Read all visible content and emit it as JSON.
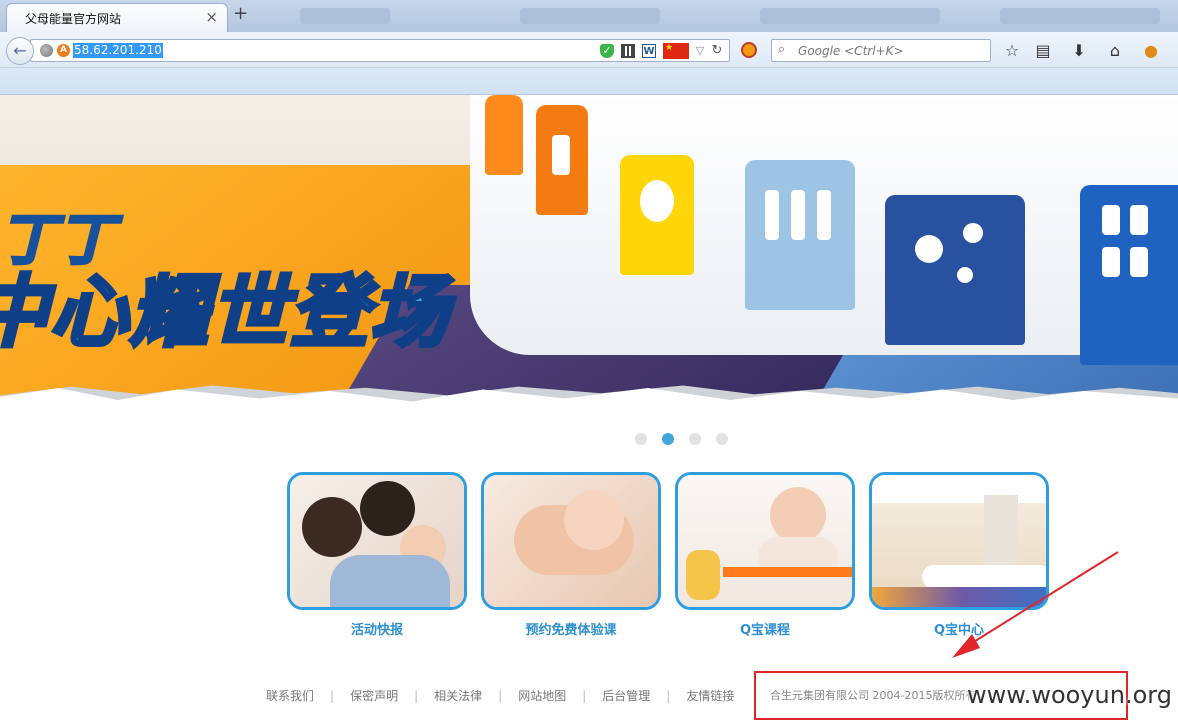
{
  "browser": {
    "tab_title": "父母能量官方网站",
    "tab_close": "×",
    "new_tab": "+",
    "url": "58.62.201.210",
    "search_placeholder": "Google <Ctrl+K>",
    "back_glyph": "←",
    "reload_glyph": "↻",
    "dropdown_glyph": "▽",
    "word_glyph": "W",
    "flag_glyph": "★",
    "search_glyph": "⌕",
    "icons": [
      "back-arrow-icon",
      "globe-icon",
      "shield-icon",
      "qr-code-icon",
      "word-icon",
      "china-flag-icon",
      "dropdown-icon",
      "reload-icon",
      "addon-icon",
      "search-icon",
      "bookmark-star-icon",
      "reading-list-icon",
      "download-icon",
      "home-icon",
      "avatar-icon"
    ],
    "toolbar_glyphs": {
      "star": "☆",
      "list": "▤",
      "download": "⬇",
      "home": "⌂",
      "avatar": "●"
    }
  },
  "banner": {
    "headline_line1": "丁丁",
    "headline_line2": "中心耀世登场",
    "slides": 4,
    "active_slide": 2
  },
  "cards": [
    {
      "label": "活动快报"
    },
    {
      "label": "预约免费体验课"
    },
    {
      "label": "Q宝课程"
    },
    {
      "label": "Q宝中心"
    }
  ],
  "footer": {
    "links": [
      "联系我们",
      "保密声明",
      "相关法律",
      "网站地图",
      "后台管理",
      "友情链接"
    ],
    "separator": "|",
    "copyright": "合生元集团有限公司  2004-2015版权所有"
  },
  "watermark": "www.wooyun.org",
  "colors": {
    "accent_blue": "#2f9ee0",
    "highlight_red": "#e0262a",
    "url_selection": "#3399ff"
  }
}
